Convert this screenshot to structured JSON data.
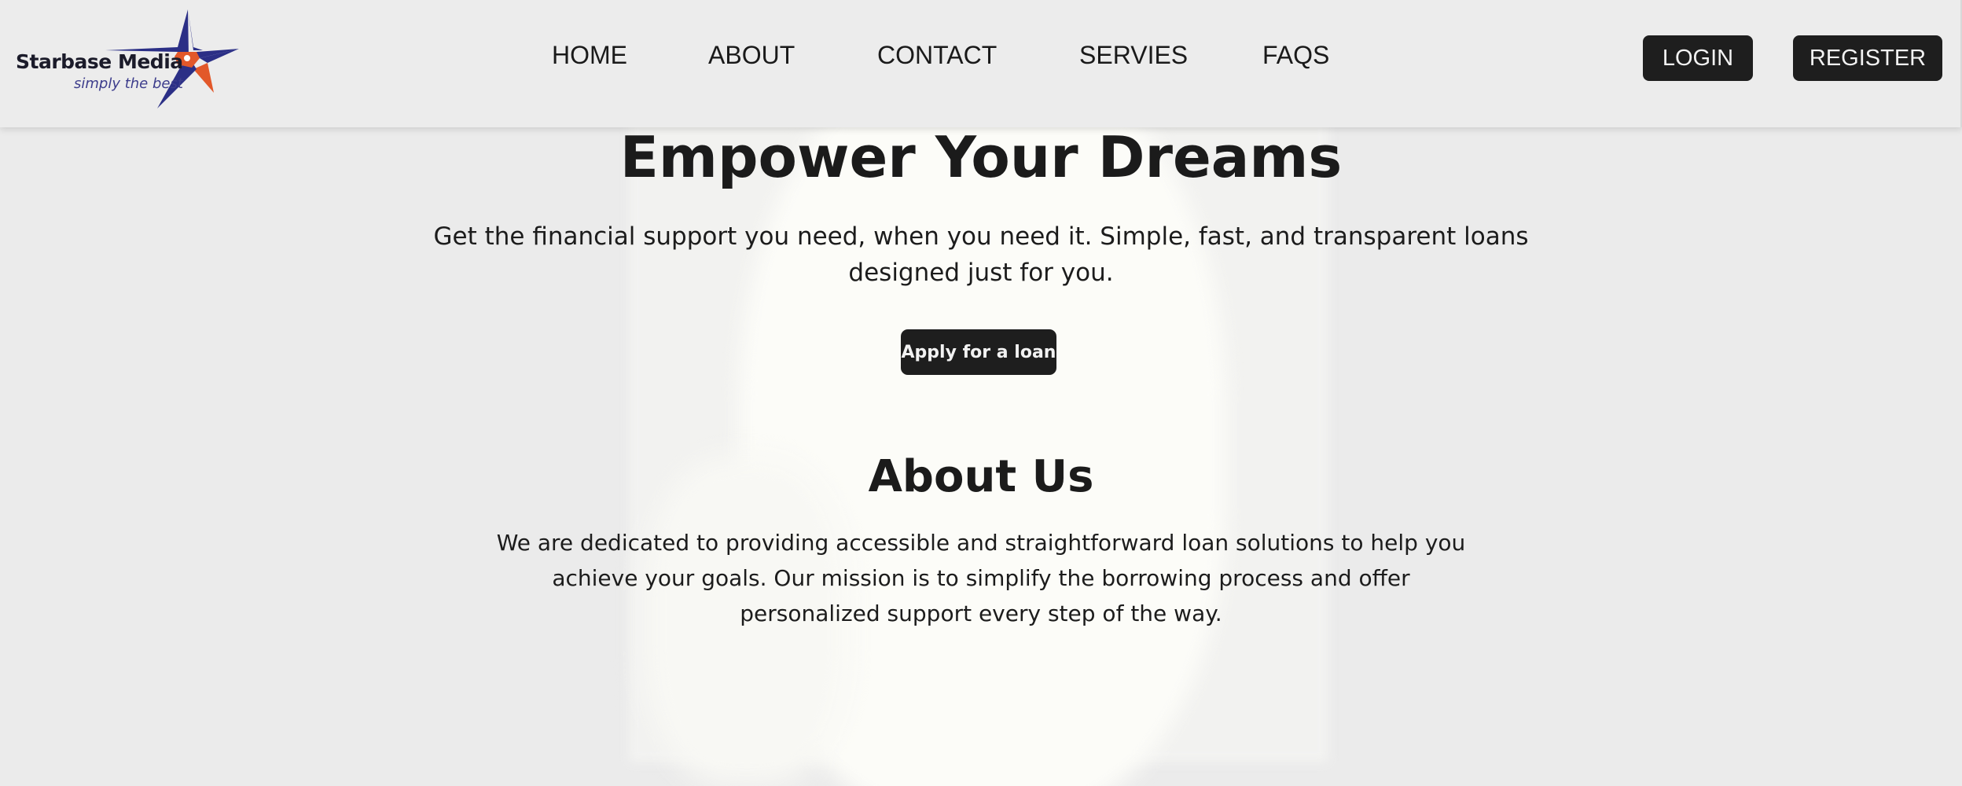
{
  "brand": {
    "name": "Starbase Media",
    "tagline": "simply the best",
    "colors": {
      "star_blue": "#2b2f86",
      "star_orange": "#e2582a",
      "logo_text": "#1b1b2a"
    }
  },
  "nav": {
    "items": [
      {
        "label": "HOME"
      },
      {
        "label": "ABOUT"
      },
      {
        "label": "CONTACT"
      },
      {
        "label": "SERVIES"
      },
      {
        "label": "FAQS"
      }
    ]
  },
  "auth": {
    "login_label": "LOGIN",
    "register_label": "REGISTER"
  },
  "hero": {
    "title": "Empower Your Dreams",
    "subtitle": "Get the financial support you need, when you need it. Simple, fast, and transparent loans designed just for you.",
    "cta_label": "Apply for a loan"
  },
  "about": {
    "title": "About Us",
    "text": "We are dedicated to providing accessible and straightforward loan solutions to help you achieve your goals. Our mission is to simplify the borrowing process and offer personalized support every step of the way."
  },
  "theme": {
    "background": "#ebebeb",
    "button_bg": "#1e1e1e",
    "button_text": "#f2f2f2"
  }
}
